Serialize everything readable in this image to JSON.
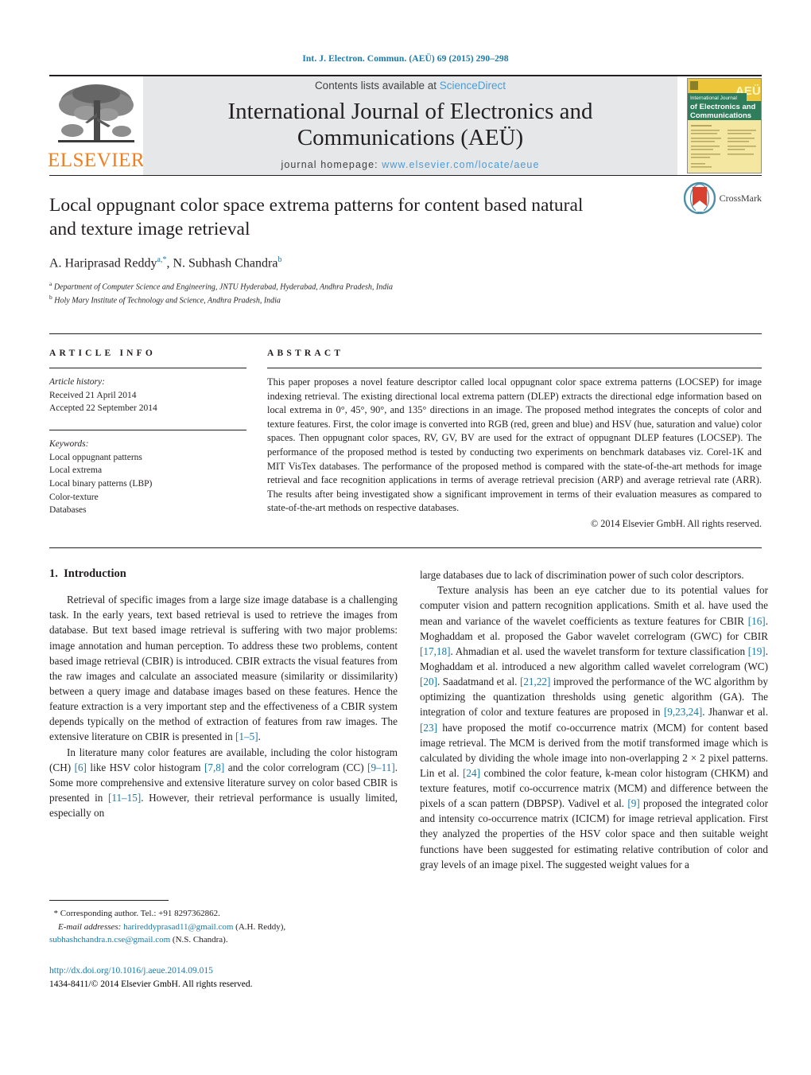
{
  "running_head": "Int. J. Electron. Commun. (AEÜ) 69 (2015) 290–298",
  "masthead": {
    "publisher_name": "ELSEVIER",
    "contents_prefix": "Contents lists available at ",
    "contents_link": "ScienceDirect",
    "journal_title_line1": "International Journal of Electronics and",
    "journal_title_line2": "Communications (AEÜ)",
    "homepage_prefix": "journal homepage:",
    "homepage_url": "www.elsevier.com/locate/aeue",
    "cover_title_line1": "International Journal",
    "cover_title_line2": "of Electronics and",
    "cover_title_line3": "Communications",
    "cover_badge": "AEÜ"
  },
  "article": {
    "title": "Local oppugnant color space extrema patterns for content based natural and texture image retrieval",
    "author1": "A. Hariprasad Reddy",
    "author1_sup": "a",
    "author1_star": ",*",
    "author2": "N. Subhash Chandra",
    "author2_sup": "b",
    "affiliation_a_sup": "a",
    "affiliation_a": "Department of Computer Science and Engineering, JNTU Hyderabad, Hyderabad, Andhra Pradesh, India",
    "affiliation_b_sup": "b",
    "affiliation_b": "Holy Mary Institute of Technology and Science, Andhra Pradesh, India",
    "crossmark_label": "CrossMark"
  },
  "article_info": {
    "heading": "ARTICLE INFO",
    "history_label": "Article history:",
    "received": "Received 21 April 2014",
    "accepted": "Accepted 22 September 2014",
    "keywords_label": "Keywords:",
    "keywords": [
      "Local oppugnant patterns",
      "Local extrema",
      "Local binary patterns (LBP)",
      "Color-texture",
      "Databases"
    ]
  },
  "abstract": {
    "heading": "ABSTRACT",
    "text": "This paper proposes a novel feature descriptor called local oppugnant color space extrema patterns (LOCSEP) for image indexing retrieval. The existing directional local extrema pattern (DLEP) extracts the directional edge information based on local extrema in 0°, 45°, 90°, and 135° directions in an image. The proposed method integrates the concepts of color and texture features. First, the color image is converted into RGB (red, green and blue) and HSV (hue, saturation and value) color spaces. Then oppugnant color spaces, RV, GV, BV are used for the extract of oppugnant DLEP features (LOCSEP). The performance of the proposed method is tested by conducting two experiments on benchmark databases viz. Corel-1K and MIT VisTex databases. The performance of the proposed method is compared with the state-of-the-art methods for image retrieval and face recognition applications in terms of average retrieval precision (ARP) and average retrieval rate (ARR). The results after being investigated show a significant improvement in terms of their evaluation measures as compared to state-of-the-art methods on respective databases.",
    "copyright": "© 2014 Elsevier GmbH. All rights reserved."
  },
  "body": {
    "section_number": "1.",
    "section_title": "Introduction",
    "left_paragraphs": [
      "Retrieval of specific images from a large size image database is a challenging task. In the early years, text based retrieval is used to retrieve the images from database. But text based image retrieval is suffering with two major problems: image annotation and human perception. To address these two problems, content based image retrieval (CBIR) is introduced. CBIR extracts the visual features from the raw images and calculate an associated measure (similarity or dissimilarity) between a query image and database images based on these features. Hence the feature extraction is a very important step and the effectiveness of a CBIR system depends typically on the method of extraction of features from raw images. The extensive literature on CBIR is presented in [1–5].",
      "In literature many color features are available, including the color histogram (CH) [6] like HSV color histogram [7,8] and the color correlogram (CC) [9–11]. Some more comprehensive and extensive literature survey on color based CBIR is presented in [11–15]. However, their retrieval performance is usually limited, especially on"
    ],
    "right_paragraphs": [
      "large databases due to lack of discrimination power of such color descriptors.",
      "Texture analysis has been an eye catcher due to its potential values for computer vision and pattern recognition applications. Smith et al. have used the mean and variance of the wavelet coefficients as texture features for CBIR [16]. Moghaddam et al. proposed the Gabor wavelet correlogram (GWC) for CBIR [17,18]. Ahmadian et al. used the wavelet transform for texture classification [19]. Moghaddam et al. introduced a new algorithm called wavelet correlogram (WC) [20]. Saadatmand et al. [21,22] improved the performance of the WC algorithm by optimizing the quantization thresholds using genetic algorithm (GA). The integration of color and texture features are proposed in [9,23,24]. Jhanwar et al. [23] have proposed the motif co-occurrence matrix (MCM) for content based image retrieval. The MCM is derived from the motif transformed image which is calculated by dividing the whole image into non-overlapping 2 × 2 pixel patterns. Lin et al. [24] combined the color feature, k-mean color histogram (CHKM) and texture features, motif co-occurrence matrix (MCM) and difference between the pixels of a scan pattern (DBPSP). Vadivel et al. [9] proposed the integrated color and intensity co-occurrence matrix (ICICM) for image retrieval application. First they analyzed the properties of the HSV color space and then suitable weight functions have been suggested for estimating relative contribution of color and gray levels of an image pixel. The suggested weight values for a"
    ]
  },
  "footnote": {
    "star": "*",
    "corresponding": "Corresponding author. Tel.: +91 8297362862.",
    "email_label": "E-mail addresses:",
    "email1": "harireddyprasad11@gmail.com",
    "email1_owner": "(A.H. Reddy),",
    "email2": "subhashchandra.n.cse@gmail.com",
    "email2_owner": "(N.S. Chandra).",
    "doi": "http://dx.doi.org/10.1016/j.aeue.2014.09.015",
    "issn_line": "1434-8411/© 2014 Elsevier GmbH. All rights reserved."
  },
  "colors": {
    "link_blue": "#1a7aa8",
    "sciencedirect_blue": "#4a9cd6",
    "elsevier_orange": "#f07f20",
    "masthead_gray": "#e6e7e8",
    "text_black": "#231f20"
  }
}
